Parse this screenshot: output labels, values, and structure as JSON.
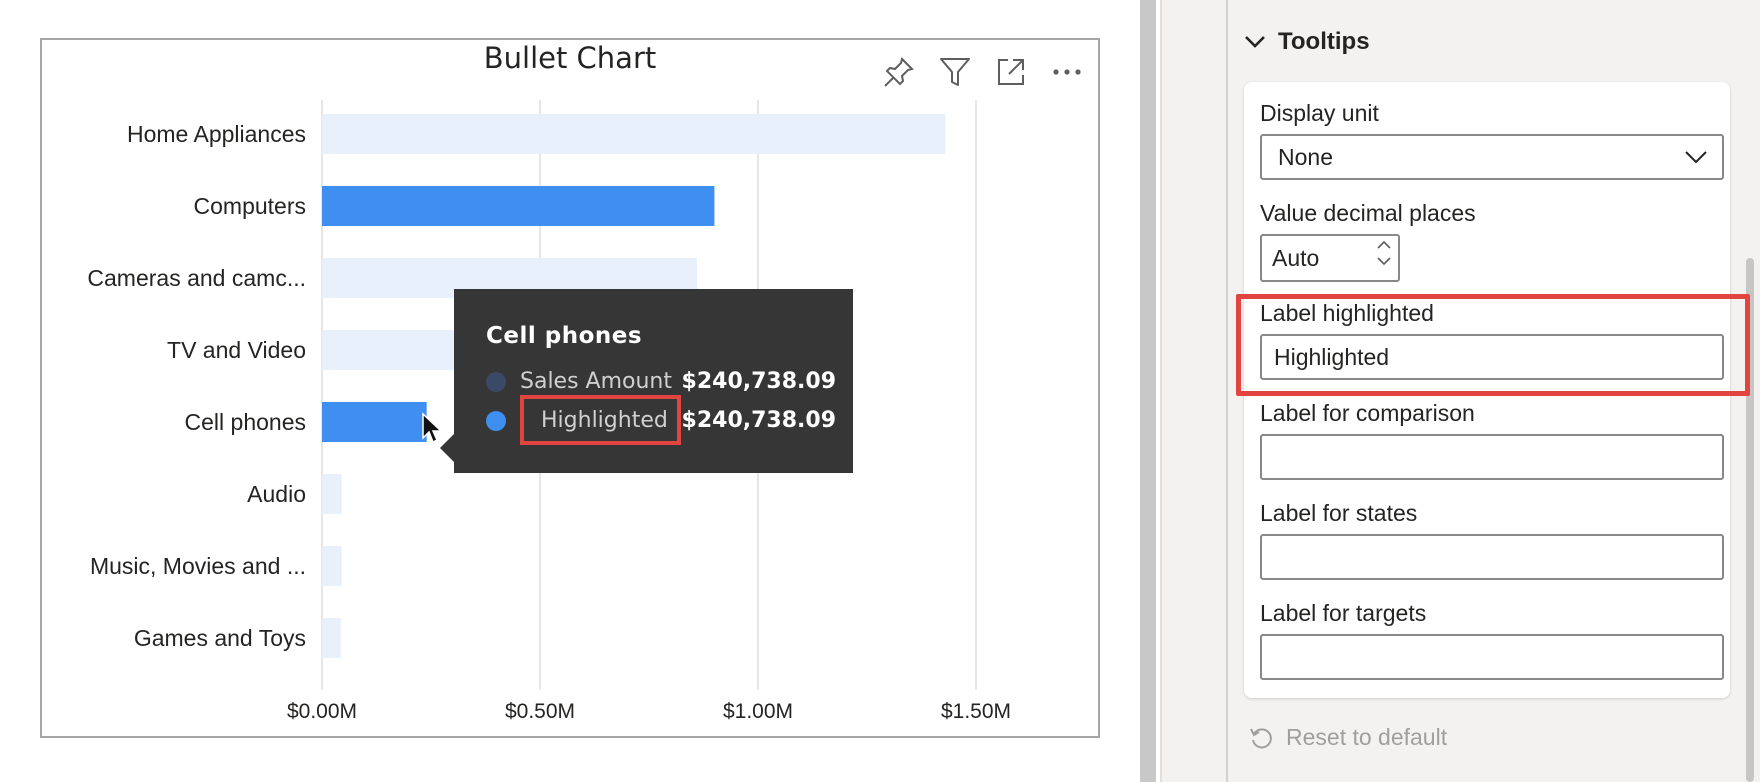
{
  "visual": {
    "title": "Bullet Chart",
    "header_icons": [
      "pin-icon",
      "filter-icon",
      "focus-mode-icon",
      "more-options-icon"
    ]
  },
  "chart_data": {
    "type": "bar",
    "orientation": "horizontal",
    "title": "Bullet Chart",
    "categories": [
      "Home Appliances",
      "Computers",
      "Cameras and camc...",
      "TV and Video",
      "Cell phones",
      "Audio",
      "Music, Movies and ...",
      "Games and Toys"
    ],
    "series": [
      {
        "name": "Sales Amount",
        "values": [
          1.43,
          0.9,
          0.86,
          0.6,
          0.24,
          0.045,
          0.045,
          0.043
        ]
      },
      {
        "name": "Highlighted",
        "values": [
          0,
          0.9,
          0,
          0,
          0.24,
          0,
          0,
          0
        ]
      }
    ],
    "x_ticks": [
      "$0.00M",
      "$0.50M",
      "$1.00M",
      "$1.50M"
    ],
    "xlim": [
      0,
      1.5
    ],
    "grid": true,
    "colors": {
      "base": "#e8f0fc",
      "highlight": "#3f8ff0"
    }
  },
  "tooltip": {
    "title": "Cell phones",
    "rows": [
      {
        "name": "Sales Amount",
        "value": "$240,738.09",
        "dot_color": "#3a4a66"
      },
      {
        "name": "Highlighted",
        "value": "$240,738.09",
        "dot_color": "#3f8ff0"
      }
    ]
  },
  "pane": {
    "section_title": "Tooltips",
    "display_unit_label": "Display unit",
    "display_unit_value": "None",
    "decimal_label": "Value decimal places",
    "decimal_value": "Auto",
    "label_highlighted": "Label highlighted",
    "label_highlighted_value": "Highlighted",
    "label_comparison": "Label for comparison",
    "label_comparison_value": "",
    "label_states": "Label for states",
    "label_states_value": "",
    "label_targets": "Label for targets",
    "label_targets_value": "",
    "reset_label": "Reset to default"
  },
  "annotation_color": "#e2453f"
}
